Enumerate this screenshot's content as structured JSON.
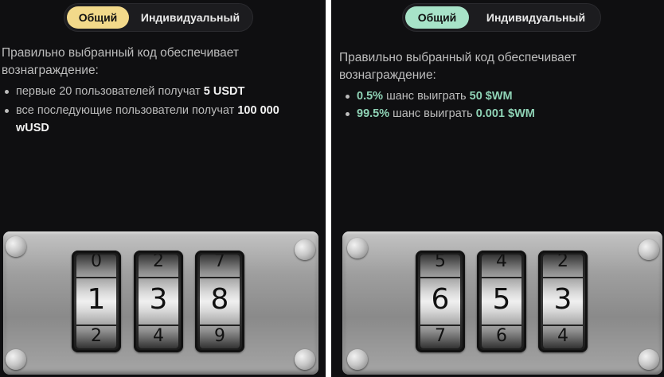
{
  "left": {
    "toggle": {
      "active_label": "Общий",
      "inactive_label": "Индивидуальный",
      "accent": "#f2d98a"
    },
    "description": "Правильно выбранный код обеспечивает вознаграждение:",
    "bullets": [
      {
        "text": "первые 20 пользователей получат ",
        "highlight": "5 USDT"
      },
      {
        "text": "все последующие пользователи получат ",
        "highlight": "100 000 wUSD"
      }
    ],
    "wheels": [
      {
        "top": "0",
        "mid": "1",
        "bot": "2"
      },
      {
        "top": "2",
        "mid": "3",
        "bot": "4"
      },
      {
        "top": "7",
        "mid": "8",
        "bot": "9"
      }
    ]
  },
  "right": {
    "toggle": {
      "active_label": "Общий",
      "inactive_label": "Индивидуальный",
      "accent": "#a7e3c8"
    },
    "description": "Правильно выбранный код обеспечивает вознаграждение:",
    "bullets": [
      {
        "lead": "0.5%",
        "text": " шанс выиграть ",
        "highlight": "50 $WM"
      },
      {
        "lead": "99.5%",
        "text": " шанс выиграть ",
        "highlight": "0.001 $WM"
      }
    ],
    "wheels": [
      {
        "top": "5",
        "mid": "6",
        "bot": "7"
      },
      {
        "top": "4",
        "mid": "5",
        "bot": "6"
      },
      {
        "top": "2",
        "mid": "3",
        "bot": "4"
      }
    ]
  }
}
